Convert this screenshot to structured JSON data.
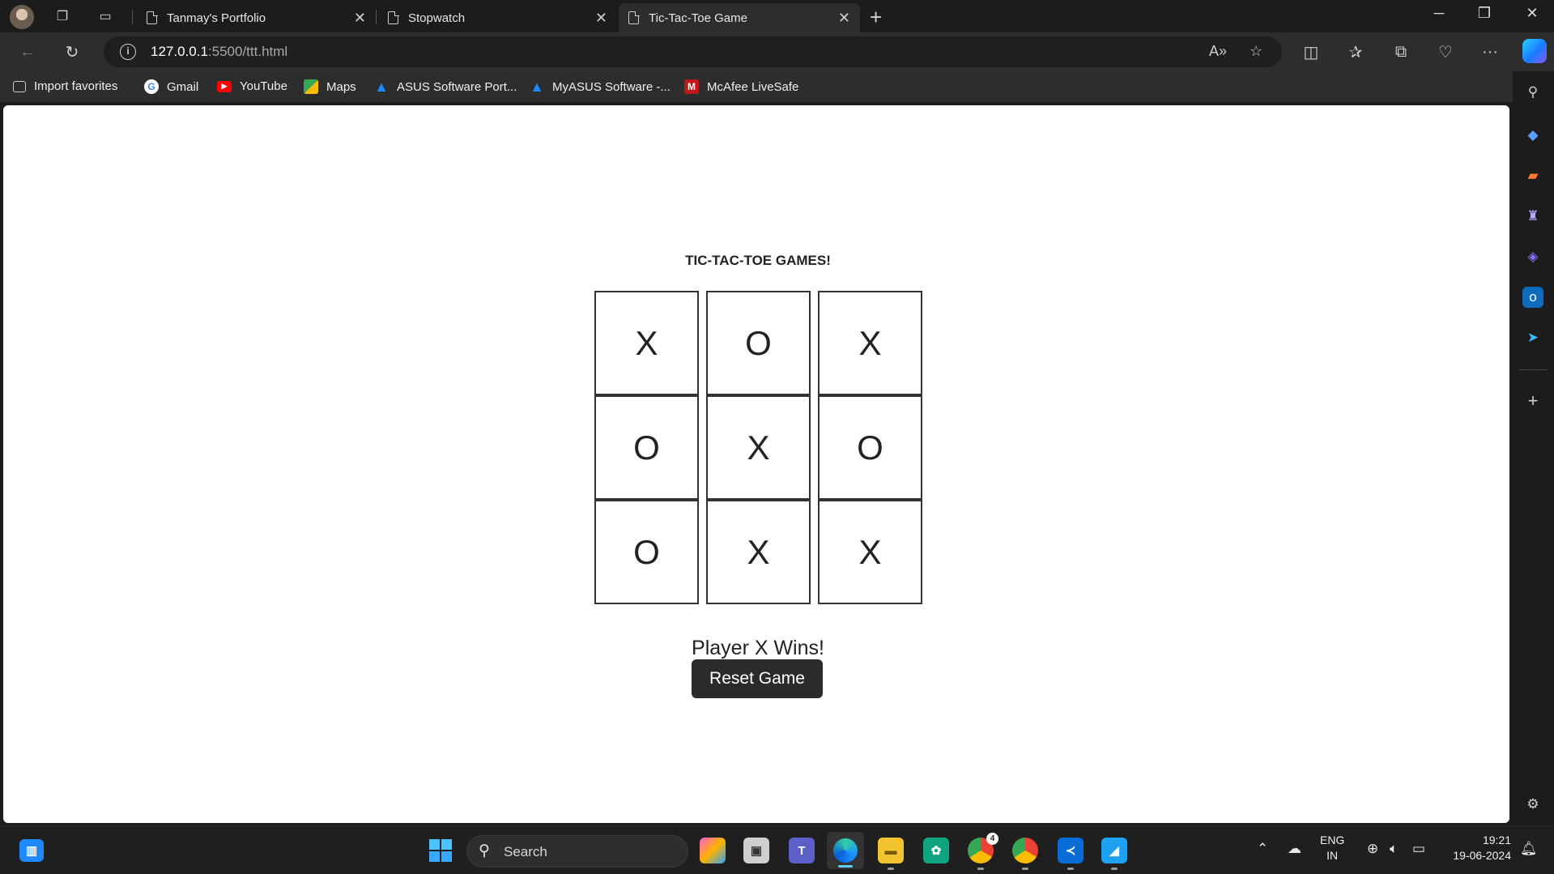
{
  "browser": {
    "tabs": [
      {
        "title": "Tanmay's Portfolio",
        "active": false
      },
      {
        "title": "Stopwatch",
        "active": false
      },
      {
        "title": "Tic-Tac-Toe Game",
        "active": true
      }
    ],
    "address": {
      "host": "127.0.0.1",
      "path": ":5500/ttt.html"
    },
    "favorites": [
      {
        "label": "Import favorites",
        "icon": "import-icon"
      },
      {
        "label": "Gmail",
        "icon": "google-icon"
      },
      {
        "label": "YouTube",
        "icon": "youtube-icon"
      },
      {
        "label": "Maps",
        "icon": "maps-icon"
      },
      {
        "label": "ASUS Software Port...",
        "icon": "asus-icon"
      },
      {
        "label": "MyASUS Software -...",
        "icon": "asus-icon"
      },
      {
        "label": "McAfee LiveSafe",
        "icon": "mcafee-icon"
      }
    ]
  },
  "game": {
    "title": "TIC-TAC-TOE GAMES!",
    "cells": [
      "X",
      "O",
      "X",
      "O",
      "X",
      "O",
      "O",
      "X",
      "X"
    ],
    "status": "Player X Wins!",
    "reset_label": "Reset Game"
  },
  "taskbar": {
    "search_label": "Search",
    "language": "ENG",
    "region": "IN",
    "time": "19:21",
    "date": "19-06-2024",
    "chrome_badge": "4"
  },
  "colors": {
    "accent": "#60cdff",
    "button_bg": "#2b2b2b",
    "board_border": "#333333"
  }
}
